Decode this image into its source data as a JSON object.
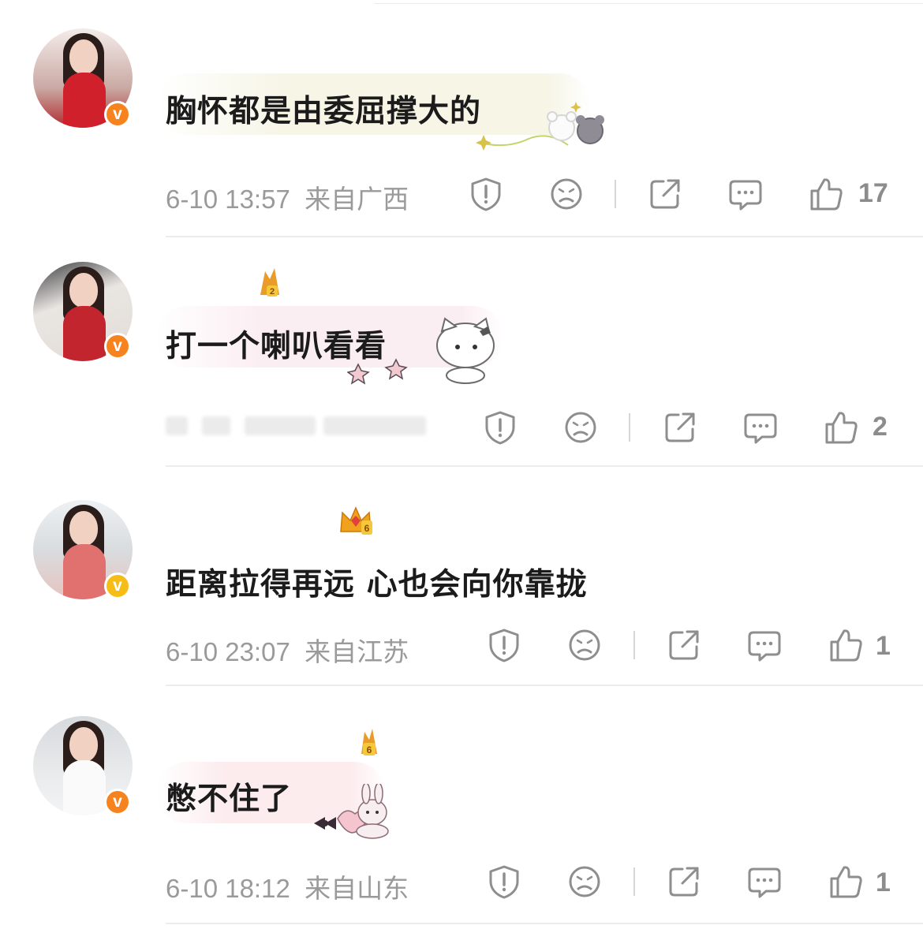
{
  "comments": [
    {
      "text": "胸怀都是由委屈撑大的",
      "date": "6-10 13:57",
      "location": "来自广西",
      "likes": "17",
      "verified_color": "#f7831e",
      "bubble_tint": "#f7f6e9",
      "meta_visible": true
    },
    {
      "text": "打一个喇叭看看",
      "date": "",
      "location": "",
      "likes": "2",
      "verified_color": "#f7831e",
      "bubble_tint": "#fbeef2",
      "level_badge": "2",
      "meta_visible": false
    },
    {
      "text": "距离拉得再远 心也会向你靠拢",
      "date": "6-10 23:07",
      "location": "来自江苏",
      "likes": "1",
      "verified_color": "#f6bd16",
      "level_badge": "6",
      "meta_visible": true
    },
    {
      "text": "憋不住了",
      "date": "6-10 18:12",
      "location": "来自山东",
      "likes": "1",
      "verified_color": "#f7831e",
      "bubble_tint": "#fcecee",
      "level_badge": "6",
      "meta_visible": true
    }
  ],
  "verified_mark": "v",
  "icons": [
    "report-icon",
    "dislike-face-icon",
    "share-icon",
    "reply-icon",
    "like-thumb-icon"
  ],
  "colors": {
    "meta_text": "#9a9a9a",
    "icon_stroke": "#8e8e8e",
    "divider": "#ececec"
  }
}
